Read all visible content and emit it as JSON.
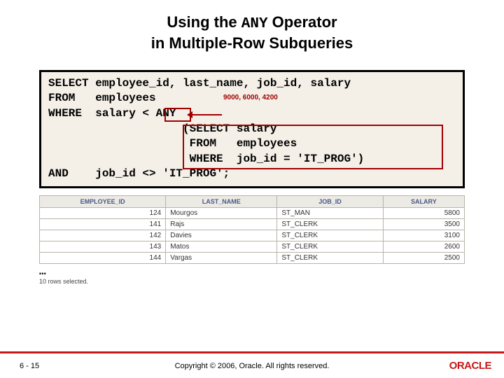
{
  "title": {
    "line1_pre": "Using the ",
    "line1_mono": "ANY",
    "line1_post": " Operator",
    "line2": "in Multiple-Row Subqueries"
  },
  "sql": {
    "l1": "SELECT employee_id, last_name, job_id, salary",
    "l2": "FROM   employees",
    "l3": "WHERE  salary < ANY",
    "l4": "                    (SELECT salary",
    "l5": "                     FROM   employees",
    "l6": "                     WHERE  job_id = 'IT_PROG')",
    "l7": "AND    job_id <> 'IT_PROG';"
  },
  "annotation": "9000, 6000, 4200",
  "table": {
    "headers": [
      "EMPLOYEE_ID",
      "LAST_NAME",
      "JOB_ID",
      "SALARY"
    ],
    "rows": [
      [
        "124",
        "Mourgos",
        "ST_MAN",
        "5800"
      ],
      [
        "141",
        "Rajs",
        "ST_CLERK",
        "3500"
      ],
      [
        "142",
        "Davies",
        "ST_CLERK",
        "3100"
      ],
      [
        "143",
        "Matos",
        "ST_CLERK",
        "2600"
      ],
      [
        "144",
        "Vargas",
        "ST_CLERK",
        "2500"
      ]
    ]
  },
  "ellipsis": "…",
  "rowcount": "10 rows selected.",
  "footer": {
    "page": "6 - 15",
    "copyright": "Copyright © 2006, Oracle. All rights reserved.",
    "logo": "ORACLE"
  }
}
